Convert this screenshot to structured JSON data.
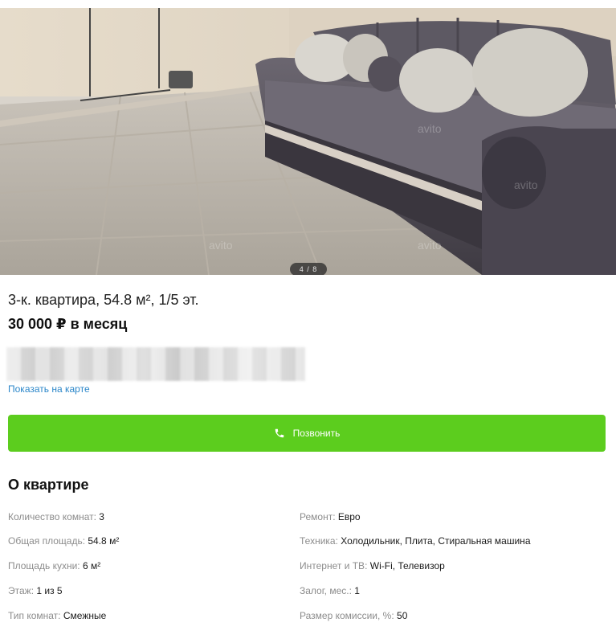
{
  "gallery": {
    "counter": "4 / 8",
    "watermark": "avito"
  },
  "listing": {
    "title": "3-к. квартира, 54.8 м², 1/5 эт.",
    "price": "30 000 ₽ в месяц",
    "map_link": "Показать на карте",
    "call_label": "Позвонить"
  },
  "about": {
    "title": "О квартире",
    "left": [
      {
        "key": "Количество комнат:",
        "value": "3"
      },
      {
        "key": "Общая площадь:",
        "value": "54.8 м²"
      },
      {
        "key": "Площадь кухни:",
        "value": "6 м²"
      },
      {
        "key": "Этаж:",
        "value": "1 из 5"
      },
      {
        "key": "Тип комнат:",
        "value": "Смежные"
      }
    ],
    "right": [
      {
        "key": "Ремонт:",
        "value": "Евро"
      },
      {
        "key": "Техника:",
        "value": "Холодильник, Плита, Стиральная машина"
      },
      {
        "key": "Интернет и ТВ:",
        "value": "Wi-Fi, Телевизор"
      },
      {
        "key": "Залог, мес.:",
        "value": "1"
      },
      {
        "key": "Размер комиссии, %:",
        "value": "50"
      }
    ]
  },
  "colors": {
    "accent_green": "#5ccd1e",
    "link_blue": "#2a86c9"
  }
}
